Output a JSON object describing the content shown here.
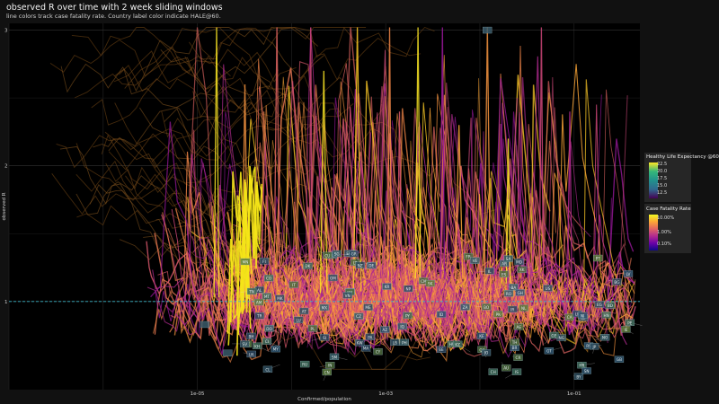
{
  "title": "observed R over time with 2 week sliding windows",
  "subtitle": "line colors track case fatality rate. Country label color indicate HALE@60.",
  "chart_data": {
    "type": "line",
    "xscale": "log",
    "xlim": [
      1e-07,
      0.5
    ],
    "ylim": [
      0.35,
      3.05
    ],
    "xlabel": "Confirmed/population",
    "ylabel": "observed R",
    "x_ticks": [
      {
        "value": 1e-05,
        "label": "1e-05"
      },
      {
        "value": 0.001,
        "label": "1e-03"
      },
      {
        "value": 0.1,
        "label": "1e-01"
      }
    ],
    "y_ticks": [
      {
        "value": 1,
        "label": "1"
      },
      {
        "value": 2,
        "label": "2"
      },
      {
        "value": 3,
        "label": "3"
      }
    ],
    "reference_line": {
      "y": 1,
      "style": "dashed",
      "color": "#3fb7c9"
    },
    "grid": true,
    "background": "#000000",
    "legends": [
      {
        "title": "Healthy Life Expectancy @60",
        "ticks": [
          "22.5",
          "20.0",
          "17.5",
          "15.0",
          "12.5"
        ],
        "colors": [
          "#fde725",
          "#35b779",
          "#21918c",
          "#31688e",
          "#440154"
        ],
        "placement": "right-upper"
      },
      {
        "title": "Case Fatality Rate",
        "ticks": [
          "10.00%",
          "1.00%",
          "0.10%"
        ],
        "colors": [
          "#f0f921",
          "#fca636",
          "#e16462",
          "#b12a90",
          "#6a00a8",
          "#0d0887"
        ],
        "placement": "right-middle"
      }
    ],
    "country_labels": [
      "AR",
      "CO",
      "AU",
      "BG",
      "EL",
      "MK",
      "HU",
      "PL",
      "SE",
      "CL",
      "RS",
      "AD",
      "BH",
      "CH",
      "IS",
      "LU",
      "QA",
      "SM",
      "CZ",
      "DE",
      "US",
      "LT",
      "BR",
      "FR",
      "IT",
      "ES",
      "GB",
      "BE",
      "IE",
      "NL",
      "PT",
      "RU",
      "SI",
      "DK",
      "NO",
      "AT",
      "FI",
      "CA",
      "IL",
      "TR",
      "JP",
      "KR",
      "CN",
      "IN",
      "MX",
      "PE",
      "ZA",
      "EC",
      "PA",
      "KZ",
      "UA",
      "RO",
      "BY",
      "AE",
      "SG",
      "SA",
      "CY",
      "MT",
      "LV",
      "EE",
      "HR",
      "BA",
      "AL",
      "GR",
      "MD",
      "UY",
      "PY",
      "BO",
      "VE",
      "CR",
      "DO",
      "GT",
      "HN",
      "NZ",
      "MY",
      "TH",
      "PH",
      "ID",
      "VN",
      "PK",
      "BD",
      "EG",
      "MA",
      "DZ",
      "TN",
      "NG",
      "GH",
      "KE",
      "CM",
      "SN",
      "CI",
      "AM",
      "AZ",
      "GE",
      "IR",
      "IQ",
      "KW",
      "OM",
      "JO",
      "LB",
      "NP",
      "LK",
      "MN",
      "KH",
      "SK",
      "ME",
      "XK",
      "CU",
      "SV",
      "NI"
    ]
  }
}
